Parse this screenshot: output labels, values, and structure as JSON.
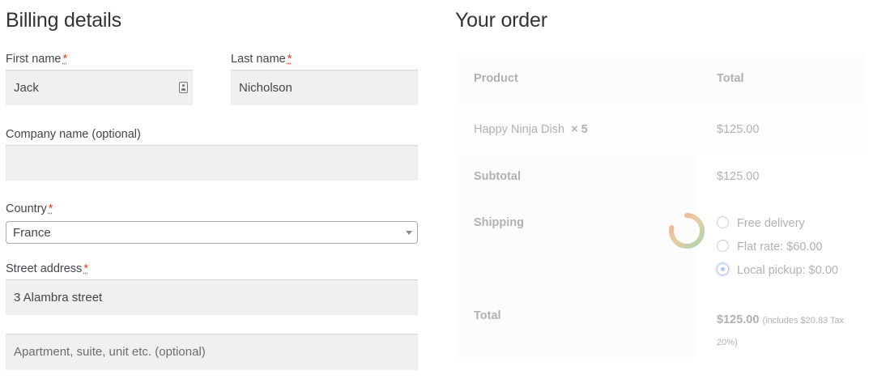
{
  "billing": {
    "title": "Billing details",
    "first_name": {
      "label": "First name",
      "required": "*",
      "value": "Jack"
    },
    "last_name": {
      "label": "Last name",
      "required": "*",
      "value": "Nicholson"
    },
    "company": {
      "label": "Company name (optional)",
      "value": ""
    },
    "country": {
      "label": "Country",
      "required": "*",
      "value": "France"
    },
    "street": {
      "label": "Street address",
      "required": "*",
      "value": "3 Alambra street",
      "line2_placeholder": "Apartment, suite, unit etc. (optional)"
    }
  },
  "order": {
    "title": "Your order",
    "headers": {
      "product": "Product",
      "total": "Total"
    },
    "item": {
      "name": "Happy Ninja Dish",
      "qty": "× 5",
      "total": "$125.00"
    },
    "subtotal": {
      "label": "Subtotal",
      "value": "$125.00"
    },
    "shipping": {
      "label": "Shipping",
      "options": [
        {
          "label": "Free delivery",
          "checked": false
        },
        {
          "label": "Flat rate: $60.00",
          "checked": false
        },
        {
          "label": "Local pickup: $0.00",
          "checked": true
        }
      ]
    },
    "total": {
      "label": "Total",
      "value": "$125.00",
      "note": "(includes $20.83 Tax 20%)"
    }
  },
  "colors": {
    "required": "#e2401c",
    "field_bg": "#f0f0f0",
    "radio_checked": "#4a7bd6"
  },
  "icons": [
    "contact-card-icon",
    "dropdown-arrow-icon",
    "loading-spinner-icon"
  ]
}
